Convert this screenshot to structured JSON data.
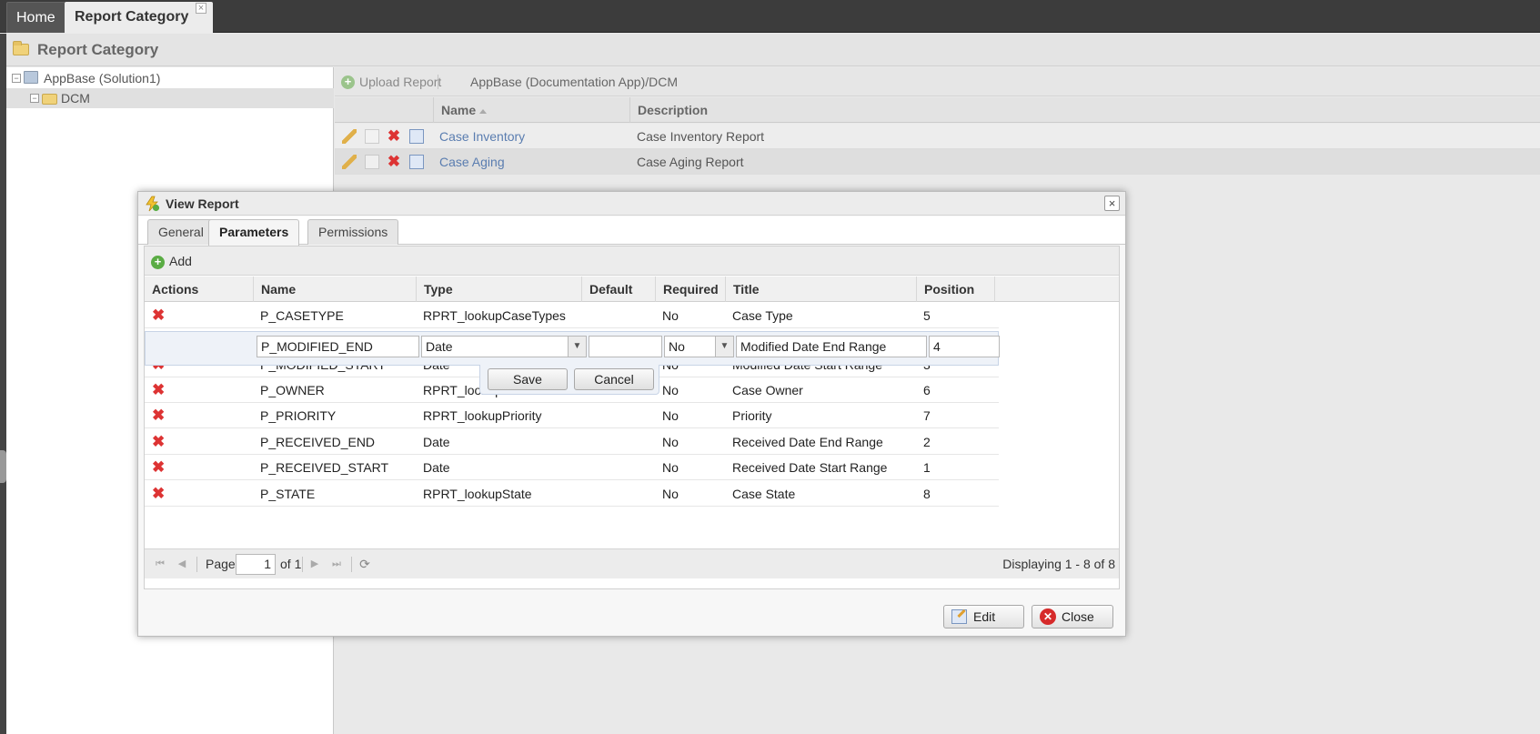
{
  "tabs": {
    "home": "Home",
    "report_category": "Report Category",
    "close_glyph": "×"
  },
  "page_title": "Report Category",
  "tree": {
    "root": {
      "label": "AppBase (Solution1)",
      "toggle": "−"
    },
    "child": {
      "label": "DCM",
      "toggle": "−"
    }
  },
  "report_toolbar": {
    "upload_label": "Upload Report",
    "breadcrumb": "AppBase (Documentation App)/DCM"
  },
  "report_grid": {
    "columns": {
      "name": "Name",
      "description": "Description"
    },
    "rows": [
      {
        "name": "Case Inventory",
        "description": "Case Inventory Report"
      },
      {
        "name": "Case Aging",
        "description": "Case Aging Report"
      }
    ]
  },
  "dialog": {
    "title": "View Report",
    "tabs": [
      "General",
      "Parameters",
      "Permissions"
    ],
    "active_tab": "Parameters",
    "add_label": "Add",
    "columns": {
      "actions": "Actions",
      "name": "Name",
      "type": "Type",
      "default": "Default",
      "required": "Required",
      "title": "Title",
      "position": "Position"
    },
    "rows": [
      {
        "name": "P_CASETYPE",
        "type": "RPRT_lookupCaseTypes",
        "default": "",
        "required": "No",
        "title": "Case Type",
        "position": "5"
      },
      {
        "name": "P_MODIFIED_START",
        "type": "Date",
        "default": "",
        "required": "No",
        "title": "Modified Date Start Range",
        "position": "3"
      },
      {
        "name": "P_OWNER",
        "type": "RPRT_lookupOwner",
        "default": "",
        "required": "No",
        "title": "Case Owner",
        "position": "6"
      },
      {
        "name": "P_PRIORITY",
        "type": "RPRT_lookupPriority",
        "default": "",
        "required": "No",
        "title": "Priority",
        "position": "7"
      },
      {
        "name": "P_RECEIVED_END",
        "type": "Date",
        "default": "",
        "required": "No",
        "title": "Received Date End Range",
        "position": "2"
      },
      {
        "name": "P_RECEIVED_START",
        "type": "Date",
        "default": "",
        "required": "No",
        "title": "Received Date Start Range",
        "position": "1"
      },
      {
        "name": "P_STATE",
        "type": "RPRT_lookupState",
        "default": "",
        "required": "No",
        "title": "Case State",
        "position": "8"
      }
    ],
    "editor": {
      "name": "P_MODIFIED_END",
      "type": "Date",
      "default": "",
      "required": "No",
      "title": "Modified Date End Range",
      "position": "4",
      "save_label": "Save",
      "cancel_label": "Cancel"
    },
    "pager": {
      "page_label": "Page",
      "page_value": "1",
      "of_label": "of 1",
      "display_info": "Displaying 1 - 8 of 8"
    },
    "edit_label": "Edit",
    "close_label": "Close"
  },
  "colors": {
    "link": "#5a7db0",
    "delete_red": "#d33333",
    "add_green": "#5aac44"
  }
}
